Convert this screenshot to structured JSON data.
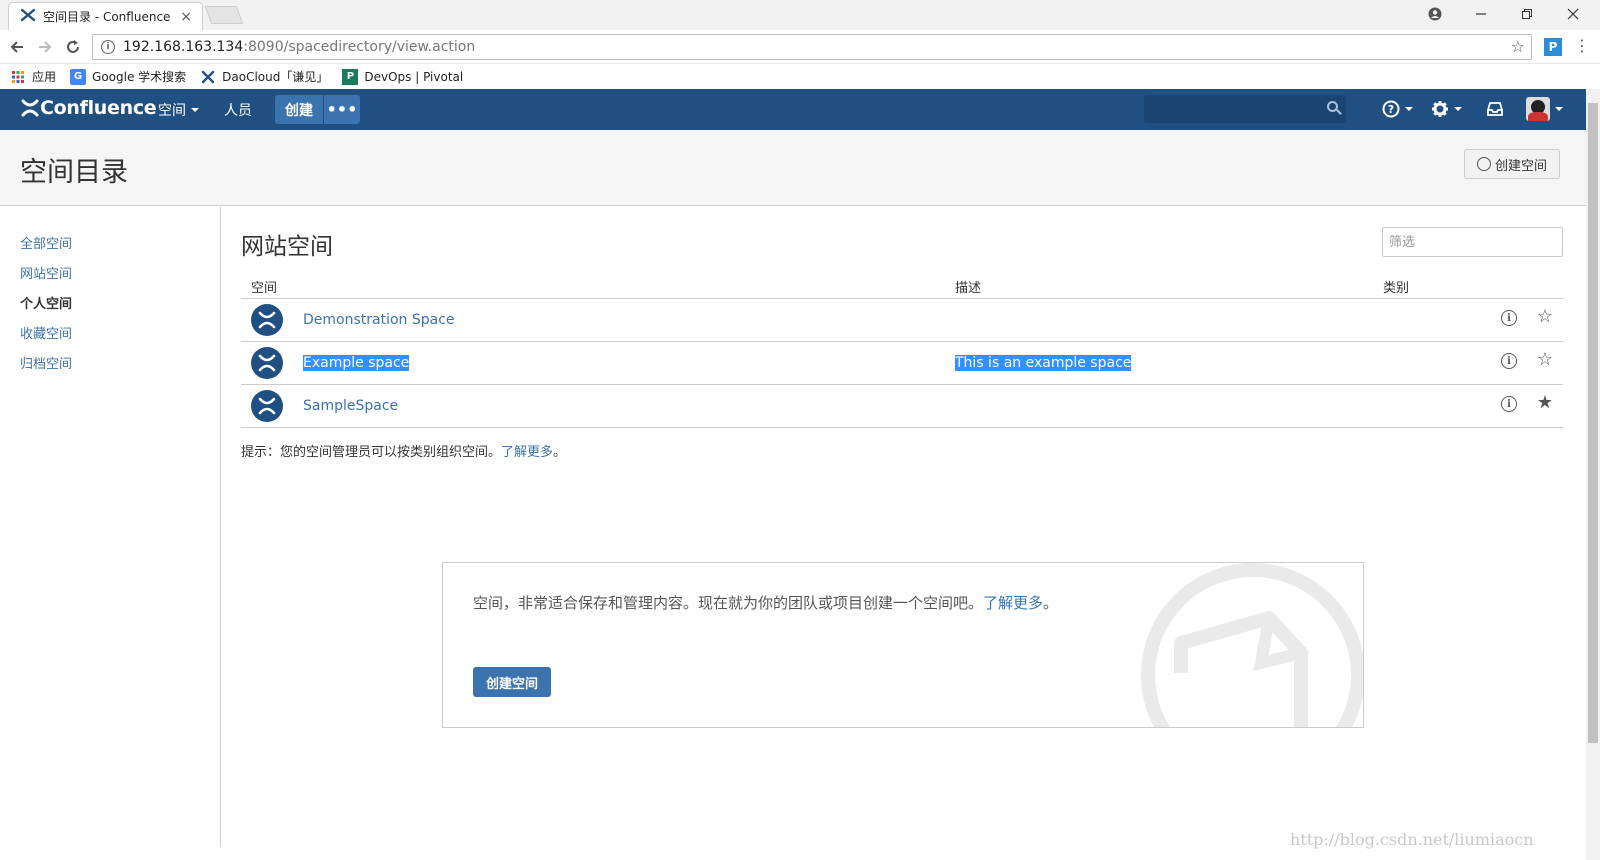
{
  "browser": {
    "tab_title": "空间目录 - Confluence",
    "tab_close": "×",
    "url_host": "192.168.163.134",
    "url_path": ":8090/spacedirectory/view.action",
    "extension_label": "P",
    "bookmarks": [
      {
        "label": "应用",
        "icon": "apps-grid-icon"
      },
      {
        "label": "Google 学术搜索",
        "icon": "google-scholar-icon"
      },
      {
        "label": "DaoCloud「谦见」",
        "icon": "daocloud-icon"
      },
      {
        "label": "DevOps | Pivotal",
        "icon": "pivotal-icon"
      }
    ]
  },
  "header": {
    "logo": "Confluence",
    "nav": [
      {
        "label": "空间",
        "dropdown": true
      },
      {
        "label": "人员",
        "dropdown": false
      }
    ],
    "create_label": "创建",
    "more_label": "•••",
    "brand_color": "#205081",
    "accent_color": "#3b73af"
  },
  "page": {
    "title": "空间目录",
    "create_space_button": "创建空间"
  },
  "sidebar": {
    "items": [
      {
        "label": "全部空间",
        "active": false
      },
      {
        "label": "网站空间",
        "active": false
      },
      {
        "label": "个人空间",
        "active": true
      },
      {
        "label": "收藏空间",
        "active": false
      },
      {
        "label": "归档空间",
        "active": false
      }
    ]
  },
  "main": {
    "section_title": "网站空间",
    "filter_placeholder": "筛选",
    "columns": [
      "空间",
      "描述",
      "类别"
    ],
    "rows": [
      {
        "name": "Demonstration Space",
        "description": "",
        "favorite": false,
        "selected": false
      },
      {
        "name": "Example space",
        "description": "This is an example space",
        "favorite": false,
        "selected": true
      },
      {
        "name": "SampleSpace",
        "description": "",
        "favorite": true,
        "selected": false
      }
    ],
    "hint_text": "提示：您的空间管理员可以按类别组织空间。",
    "hint_link": "了解更多",
    "hint_end": "。"
  },
  "blank_state": {
    "text": "空间，非常适合保存和管理内容。现在就为你的团队或项目创建一个空间吧。",
    "link": "了解更多",
    "end": "。",
    "button": "创建空间"
  },
  "watermark": "http://blog.csdn.net/liumiaocn"
}
